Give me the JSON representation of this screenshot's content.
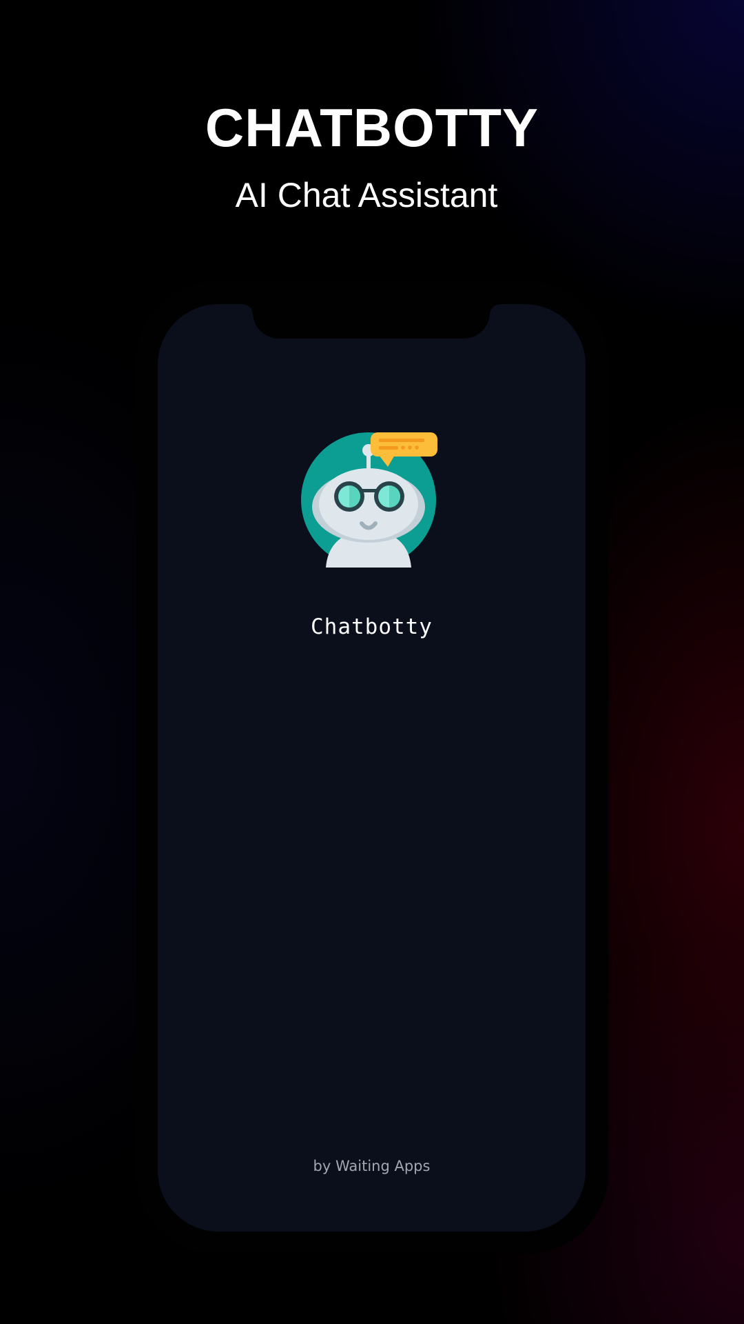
{
  "promo": {
    "headline": "CHATBOTTY",
    "subheadline": "AI Chat Assistant"
  },
  "splash": {
    "logo_icon": "robot-chat-bubble-icon",
    "app_name": "Chatbotty",
    "byline": "by Waiting Apps"
  },
  "colors": {
    "screen_background": "#0b0f1b",
    "logo_circle": "#0c9e92",
    "speech_bubble": "#fbbd3a",
    "byline_text": "#a3a7b0"
  }
}
